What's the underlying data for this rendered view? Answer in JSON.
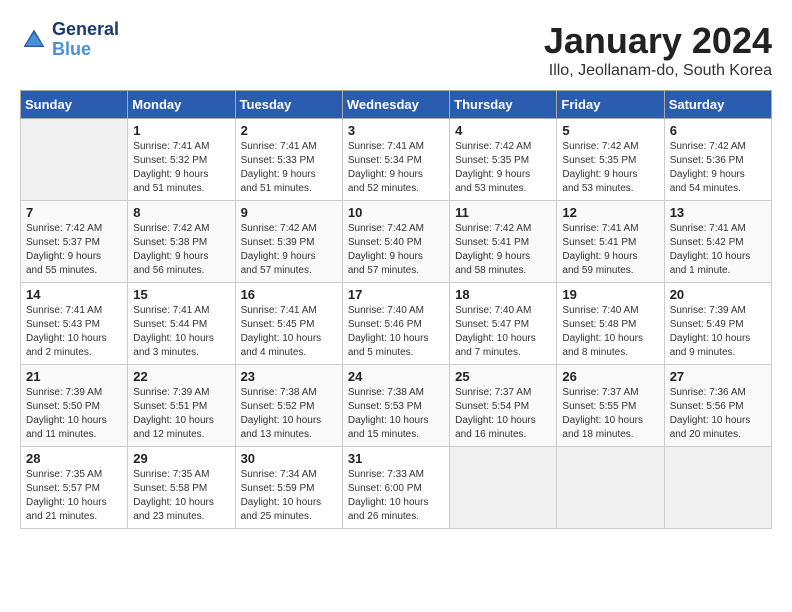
{
  "header": {
    "logo_line1": "General",
    "logo_line2": "Blue",
    "month_title": "January 2024",
    "subtitle": "Illo, Jeollanam-do, South Korea"
  },
  "weekdays": [
    "Sunday",
    "Monday",
    "Tuesday",
    "Wednesday",
    "Thursday",
    "Friday",
    "Saturday"
  ],
  "weeks": [
    [
      {
        "day": "",
        "info": ""
      },
      {
        "day": "1",
        "info": "Sunrise: 7:41 AM\nSunset: 5:32 PM\nDaylight: 9 hours\nand 51 minutes."
      },
      {
        "day": "2",
        "info": "Sunrise: 7:41 AM\nSunset: 5:33 PM\nDaylight: 9 hours\nand 51 minutes."
      },
      {
        "day": "3",
        "info": "Sunrise: 7:41 AM\nSunset: 5:34 PM\nDaylight: 9 hours\nand 52 minutes."
      },
      {
        "day": "4",
        "info": "Sunrise: 7:42 AM\nSunset: 5:35 PM\nDaylight: 9 hours\nand 53 minutes."
      },
      {
        "day": "5",
        "info": "Sunrise: 7:42 AM\nSunset: 5:35 PM\nDaylight: 9 hours\nand 53 minutes."
      },
      {
        "day": "6",
        "info": "Sunrise: 7:42 AM\nSunset: 5:36 PM\nDaylight: 9 hours\nand 54 minutes."
      }
    ],
    [
      {
        "day": "7",
        "info": "Sunrise: 7:42 AM\nSunset: 5:37 PM\nDaylight: 9 hours\nand 55 minutes."
      },
      {
        "day": "8",
        "info": "Sunrise: 7:42 AM\nSunset: 5:38 PM\nDaylight: 9 hours\nand 56 minutes."
      },
      {
        "day": "9",
        "info": "Sunrise: 7:42 AM\nSunset: 5:39 PM\nDaylight: 9 hours\nand 57 minutes."
      },
      {
        "day": "10",
        "info": "Sunrise: 7:42 AM\nSunset: 5:40 PM\nDaylight: 9 hours\nand 57 minutes."
      },
      {
        "day": "11",
        "info": "Sunrise: 7:42 AM\nSunset: 5:41 PM\nDaylight: 9 hours\nand 58 minutes."
      },
      {
        "day": "12",
        "info": "Sunrise: 7:41 AM\nSunset: 5:41 PM\nDaylight: 9 hours\nand 59 minutes."
      },
      {
        "day": "13",
        "info": "Sunrise: 7:41 AM\nSunset: 5:42 PM\nDaylight: 10 hours\nand 1 minute."
      }
    ],
    [
      {
        "day": "14",
        "info": "Sunrise: 7:41 AM\nSunset: 5:43 PM\nDaylight: 10 hours\nand 2 minutes."
      },
      {
        "day": "15",
        "info": "Sunrise: 7:41 AM\nSunset: 5:44 PM\nDaylight: 10 hours\nand 3 minutes."
      },
      {
        "day": "16",
        "info": "Sunrise: 7:41 AM\nSunset: 5:45 PM\nDaylight: 10 hours\nand 4 minutes."
      },
      {
        "day": "17",
        "info": "Sunrise: 7:40 AM\nSunset: 5:46 PM\nDaylight: 10 hours\nand 5 minutes."
      },
      {
        "day": "18",
        "info": "Sunrise: 7:40 AM\nSunset: 5:47 PM\nDaylight: 10 hours\nand 7 minutes."
      },
      {
        "day": "19",
        "info": "Sunrise: 7:40 AM\nSunset: 5:48 PM\nDaylight: 10 hours\nand 8 minutes."
      },
      {
        "day": "20",
        "info": "Sunrise: 7:39 AM\nSunset: 5:49 PM\nDaylight: 10 hours\nand 9 minutes."
      }
    ],
    [
      {
        "day": "21",
        "info": "Sunrise: 7:39 AM\nSunset: 5:50 PM\nDaylight: 10 hours\nand 11 minutes."
      },
      {
        "day": "22",
        "info": "Sunrise: 7:39 AM\nSunset: 5:51 PM\nDaylight: 10 hours\nand 12 minutes."
      },
      {
        "day": "23",
        "info": "Sunrise: 7:38 AM\nSunset: 5:52 PM\nDaylight: 10 hours\nand 13 minutes."
      },
      {
        "day": "24",
        "info": "Sunrise: 7:38 AM\nSunset: 5:53 PM\nDaylight: 10 hours\nand 15 minutes."
      },
      {
        "day": "25",
        "info": "Sunrise: 7:37 AM\nSunset: 5:54 PM\nDaylight: 10 hours\nand 16 minutes."
      },
      {
        "day": "26",
        "info": "Sunrise: 7:37 AM\nSunset: 5:55 PM\nDaylight: 10 hours\nand 18 minutes."
      },
      {
        "day": "27",
        "info": "Sunrise: 7:36 AM\nSunset: 5:56 PM\nDaylight: 10 hours\nand 20 minutes."
      }
    ],
    [
      {
        "day": "28",
        "info": "Sunrise: 7:35 AM\nSunset: 5:57 PM\nDaylight: 10 hours\nand 21 minutes."
      },
      {
        "day": "29",
        "info": "Sunrise: 7:35 AM\nSunset: 5:58 PM\nDaylight: 10 hours\nand 23 minutes."
      },
      {
        "day": "30",
        "info": "Sunrise: 7:34 AM\nSunset: 5:59 PM\nDaylight: 10 hours\nand 25 minutes."
      },
      {
        "day": "31",
        "info": "Sunrise: 7:33 AM\nSunset: 6:00 PM\nDaylight: 10 hours\nand 26 minutes."
      },
      {
        "day": "",
        "info": ""
      },
      {
        "day": "",
        "info": ""
      },
      {
        "day": "",
        "info": ""
      }
    ]
  ]
}
